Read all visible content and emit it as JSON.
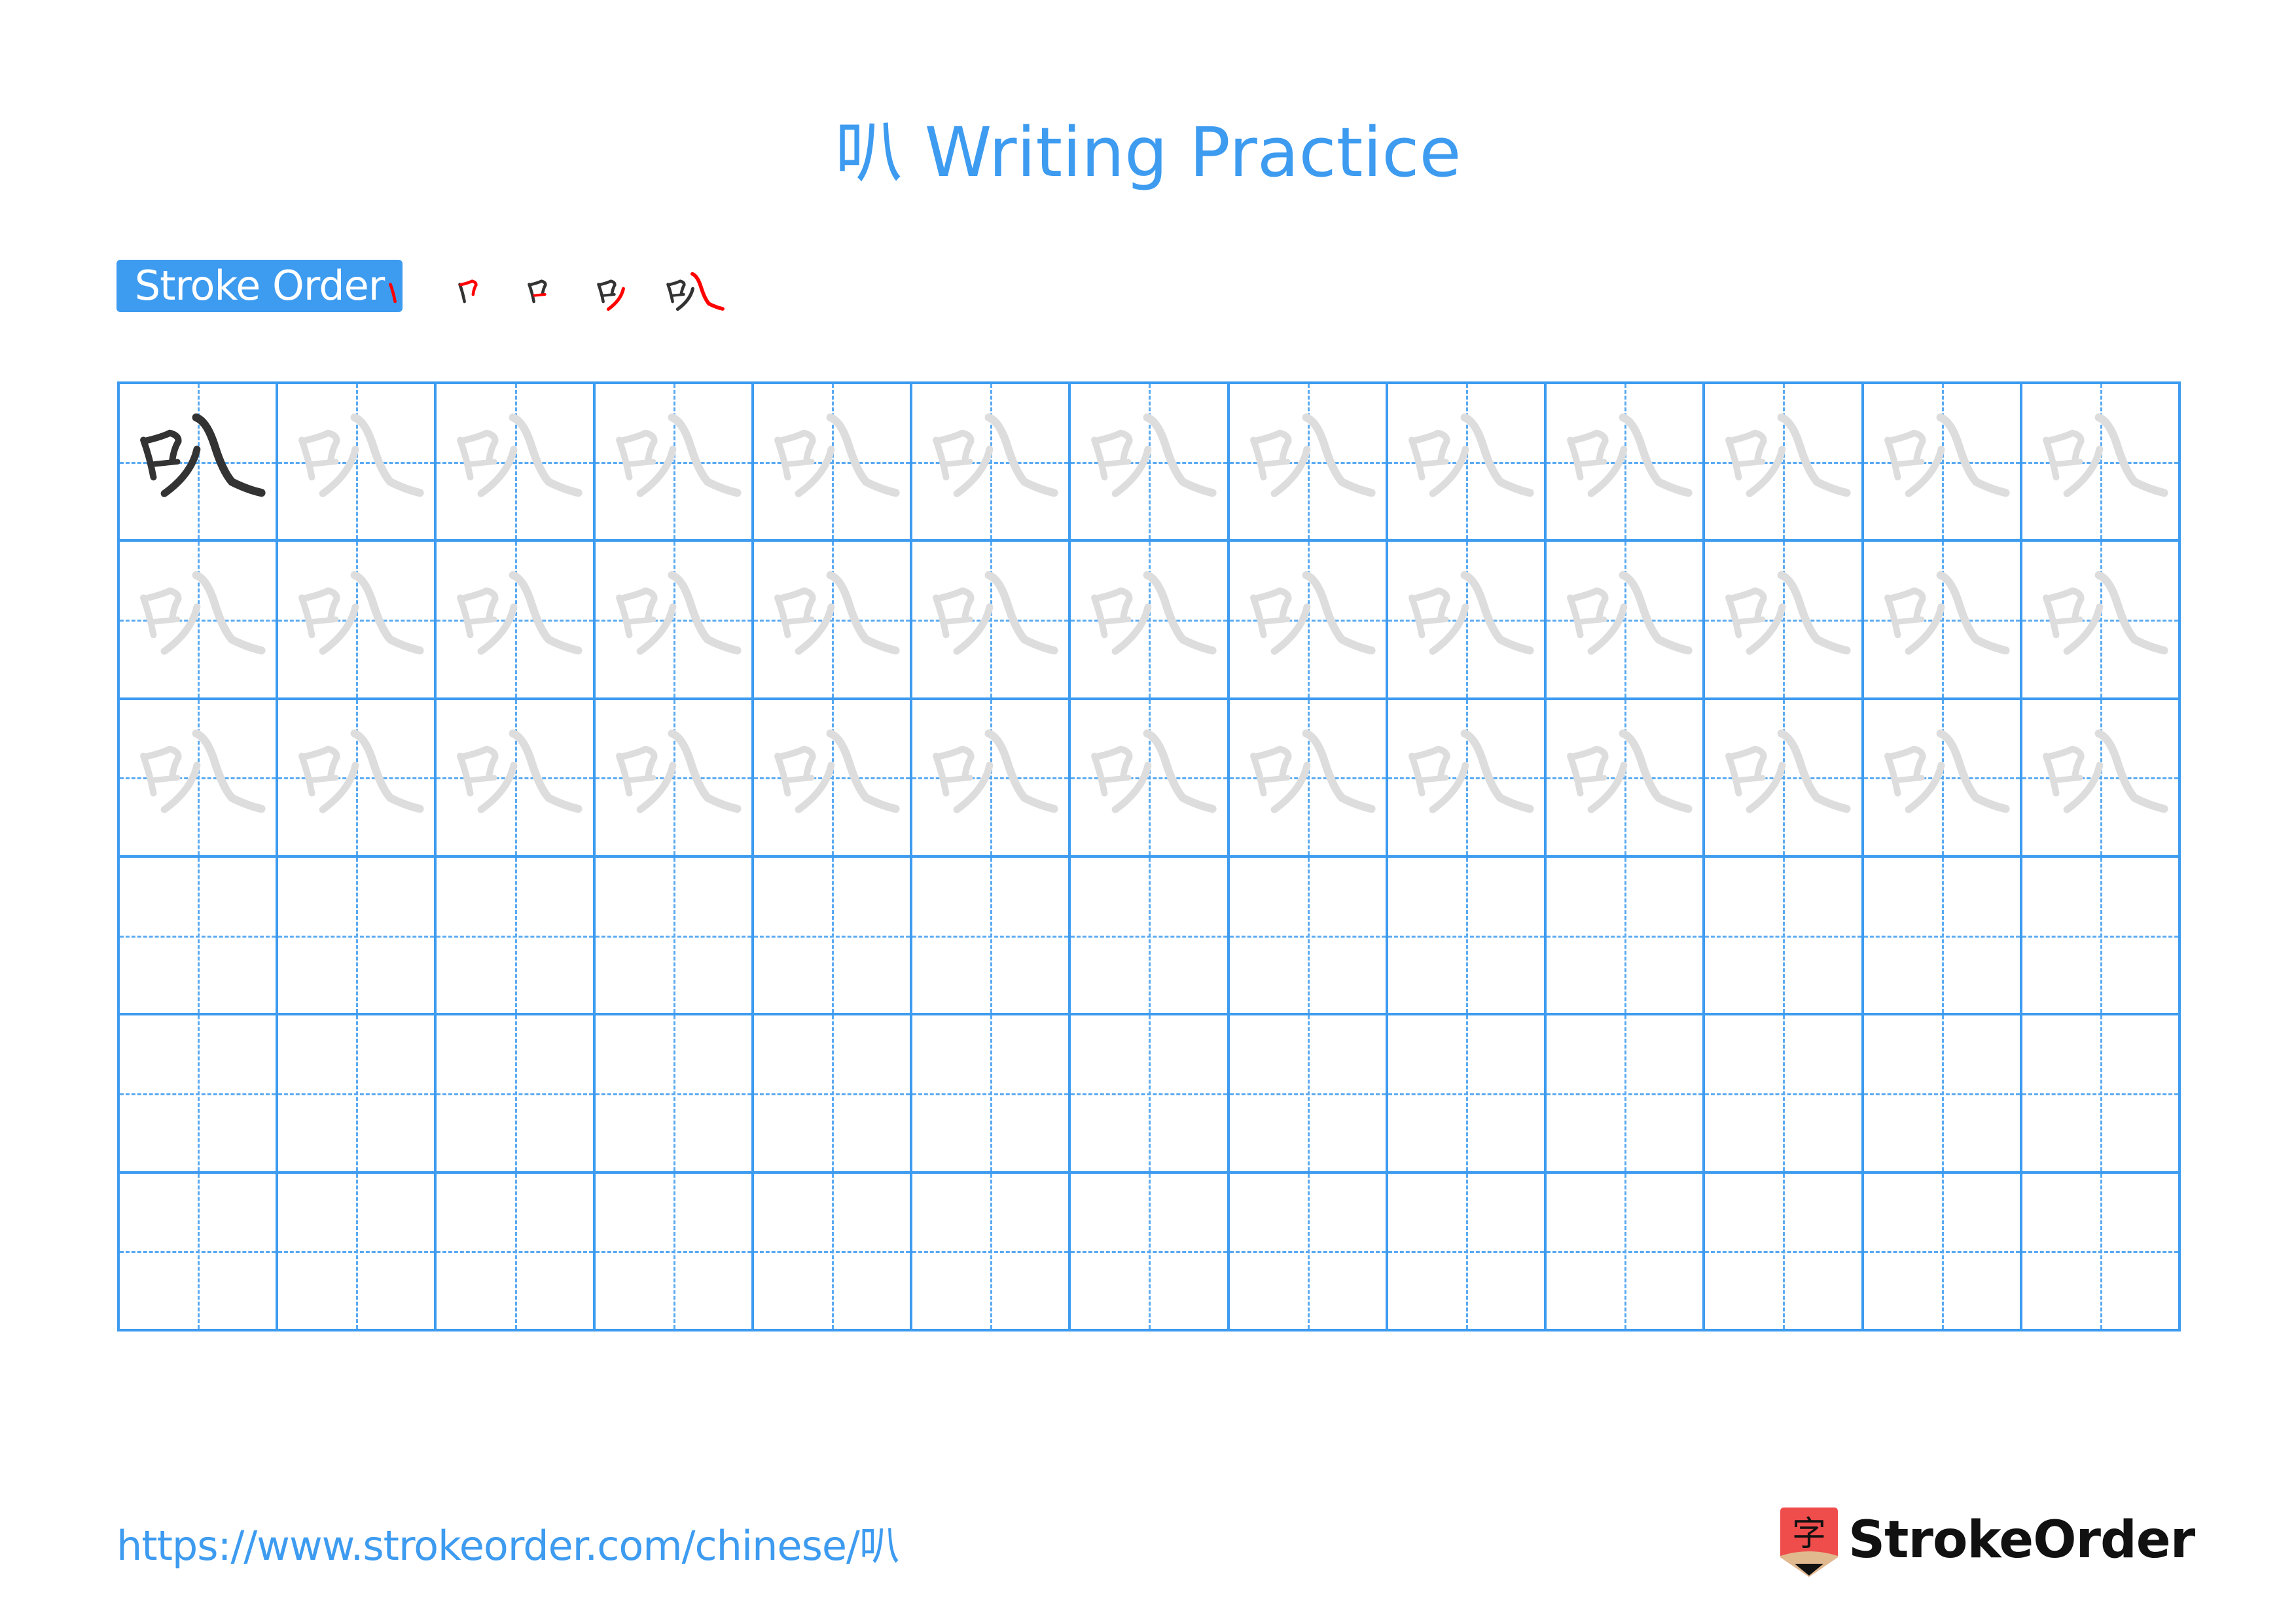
{
  "page": {
    "title": "叭 Writing Practice",
    "character": "叭"
  },
  "stroke_order": {
    "label": "Stroke Order",
    "stroke_count": 5,
    "steps": [
      {
        "step": 1,
        "name": "stroke-step-1"
      },
      {
        "step": 2,
        "name": "stroke-step-2"
      },
      {
        "step": 3,
        "name": "stroke-step-3"
      },
      {
        "step": 4,
        "name": "stroke-step-4"
      },
      {
        "step": 5,
        "name": "stroke-step-5"
      }
    ]
  },
  "grid": {
    "rows": 6,
    "columns": 13,
    "first_cell": "solid",
    "traced_rows": 3,
    "blank_rows": 3
  },
  "colors": {
    "accent": "#3d9bf0",
    "model_character": "#333333",
    "trace_character": "#dddddd",
    "current_stroke": "#ff0000",
    "logo_red": "#ef4c4c",
    "logo_tan": "#e0b98f"
  },
  "footer": {
    "url": "https://www.strokeorder.com/chinese/叭",
    "brand": "StrokeOrder",
    "brand_icon_char": "字"
  }
}
